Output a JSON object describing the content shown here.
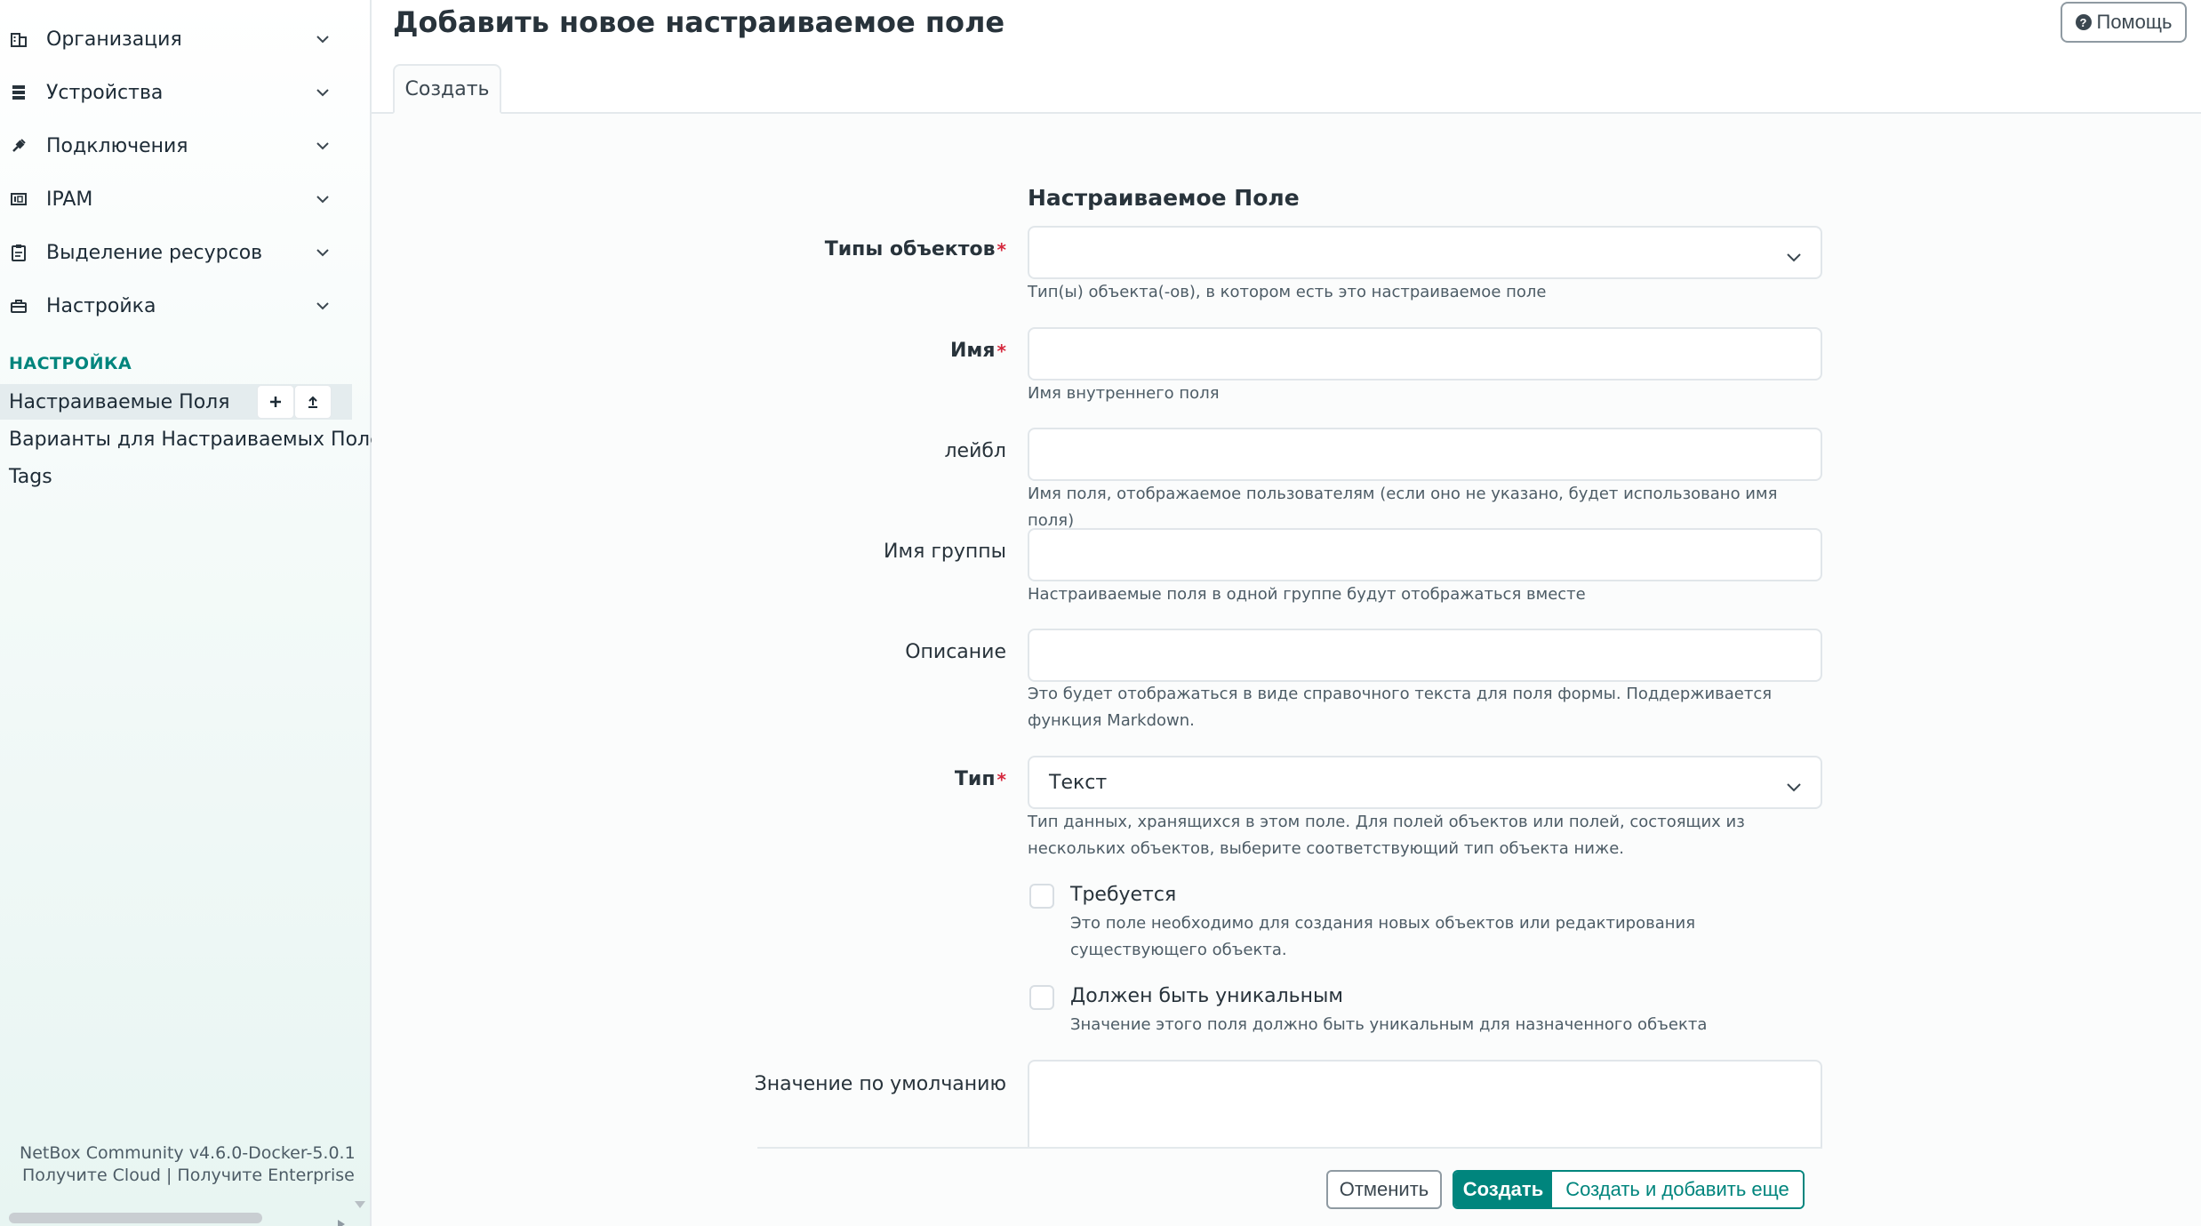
{
  "sidebar": {
    "groups": [
      {
        "label": "Организация",
        "icon": "building-icon"
      },
      {
        "label": "Устройства",
        "icon": "server-icon"
      },
      {
        "label": "Подключения",
        "icon": "plug-icon"
      },
      {
        "label": "IPAM",
        "icon": "ip-card-icon"
      },
      {
        "label": "Выделение ресурсов",
        "icon": "clipboard-icon"
      },
      {
        "label": "Настройка",
        "icon": "toolbox-icon"
      }
    ],
    "section_title": "НАСТРОЙКА",
    "items": [
      {
        "label": "Настраиваемые Поля",
        "active": true
      },
      {
        "label": "Варианты для Настраиваемых Полей"
      },
      {
        "label": "Tags"
      }
    ],
    "footer": {
      "version": "NetBox Community v4.6.0-Docker-5.0.1",
      "links": "Получите Cloud | Получите Enterprise"
    }
  },
  "header": {
    "title": "Добавить новое настраиваемое поле",
    "help_label": "Помощь"
  },
  "tabs": [
    {
      "label": "Создать"
    }
  ],
  "form": {
    "heading": "Настраиваемое Поле",
    "object_types": {
      "label": "Типы объектов",
      "value": "",
      "help": "Тип(ы) объекта(-ов), в котором есть это настраиваемое поле"
    },
    "name": {
      "label": "Имя",
      "value": "",
      "help": "Имя внутреннего поля"
    },
    "label": {
      "label": "лейбл",
      "value": "",
      "help": "Имя поля, отображаемое пользователям (если оно не указано, будет использовано имя поля)"
    },
    "group_name": {
      "label": "Имя группы",
      "value": "",
      "help": "Настраиваемые поля в одной группе будут отображаться вместе"
    },
    "description": {
      "label": "Описание",
      "value": "",
      "help": "Это будет отображаться в виде справочного текста для поля формы. Поддерживается функция Markdown."
    },
    "type": {
      "label": "Тип",
      "value": "Текст",
      "help": "Тип данных, хранящихся в этом поле. Для полей объектов или полей, состоящих из нескольких объектов, выберите соответствующий тип объекта ниже."
    },
    "required": {
      "label": "Требуется",
      "checked": false,
      "help": "Это поле необходимо для создания новых объектов или редактирования существующего объекта."
    },
    "unique": {
      "label": "Должен быть уникальным",
      "checked": false,
      "help": "Значение этого поля должно быть уникальным для назначенного объекта"
    },
    "default": {
      "label": "Значение по умолчанию",
      "value": ""
    }
  },
  "buttons": {
    "cancel": "Отменить",
    "create": "Создать",
    "create_more": "Создать и добавить еще"
  },
  "colors": {
    "accent": "#00857d",
    "required": "#d6293e"
  }
}
